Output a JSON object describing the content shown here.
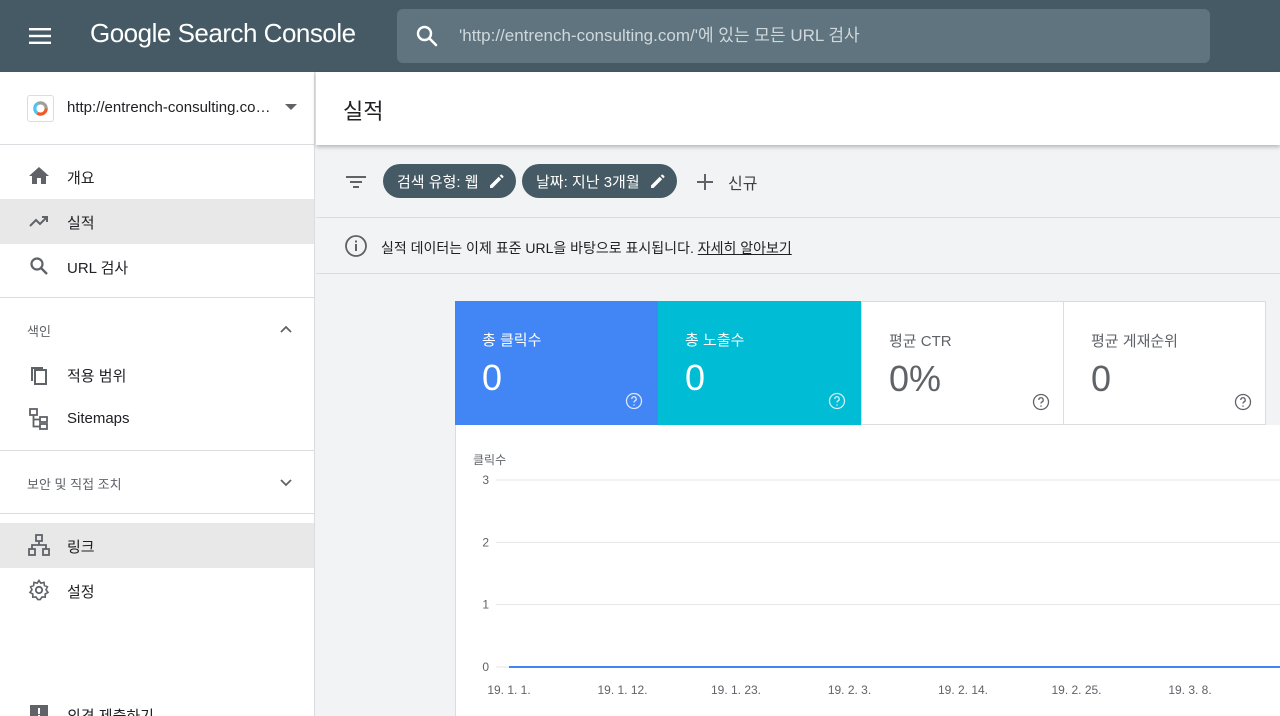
{
  "app": {
    "title": "Google Search Console",
    "colors": {
      "topbar": "#455a64",
      "clicks": "#4285f4",
      "impressions": "#00bcd4"
    }
  },
  "search": {
    "placeholder": "'http://entrench-consulting.com/'에 있는 모든 URL 검사",
    "icon": "search-icon"
  },
  "property": {
    "label": "http://entrench-consulting.com/",
    "icon": "property-favicon-icon"
  },
  "nav": {
    "items": [
      {
        "label": "개요",
        "icon": "home-icon"
      },
      {
        "label": "실적",
        "icon": "trending-up-icon"
      },
      {
        "label": "URL 검사",
        "icon": "search-icon"
      }
    ],
    "index_section": {
      "title": "색인",
      "items": [
        {
          "label": "적용 범위",
          "icon": "copy-icon"
        },
        {
          "label": "Sitemaps",
          "icon": "sitemap-icon"
        }
      ]
    },
    "security_section": {
      "title": "보안 및 직접 조치"
    },
    "bottom_items": [
      {
        "label": "링크",
        "icon": "links-icon"
      },
      {
        "label": "설정",
        "icon": "gear-icon"
      }
    ],
    "feedback": {
      "label": "의견 제출하기",
      "icon": "feedback-icon"
    }
  },
  "page": {
    "title": "실적"
  },
  "filters": {
    "chips": [
      {
        "label": "검색 유형: 웹"
      },
      {
        "label": "날짜: 지난 3개월"
      }
    ],
    "new_label": "신규"
  },
  "info": {
    "text": "실적 데이터는 이제 표준 URL을 바탕으로 표시됩니다.",
    "link": "자세히 알아보기"
  },
  "metrics": [
    {
      "label": "총 클릭수",
      "value": "0",
      "selected": true
    },
    {
      "label": "총 노출수",
      "value": "0",
      "selected": true
    },
    {
      "label": "평균 CTR",
      "value": "0%",
      "selected": false
    },
    {
      "label": "평균 게재순위",
      "value": "0",
      "selected": false
    }
  ],
  "chart_data": {
    "type": "line",
    "title": "",
    "ylabel": "클릭수",
    "xlabel": "",
    "ylim": [
      0,
      3
    ],
    "yticks": [
      "3",
      "2",
      "1",
      "0"
    ],
    "x": [
      "19. 1. 1.",
      "19. 1. 12.",
      "19. 1. 23.",
      "19. 2. 3.",
      "19. 2. 14.",
      "19. 2. 25.",
      "19. 3. 8."
    ],
    "series": [
      {
        "values": [
          0,
          0,
          0,
          0,
          0,
          0,
          0
        ]
      }
    ],
    "grid": true
  }
}
